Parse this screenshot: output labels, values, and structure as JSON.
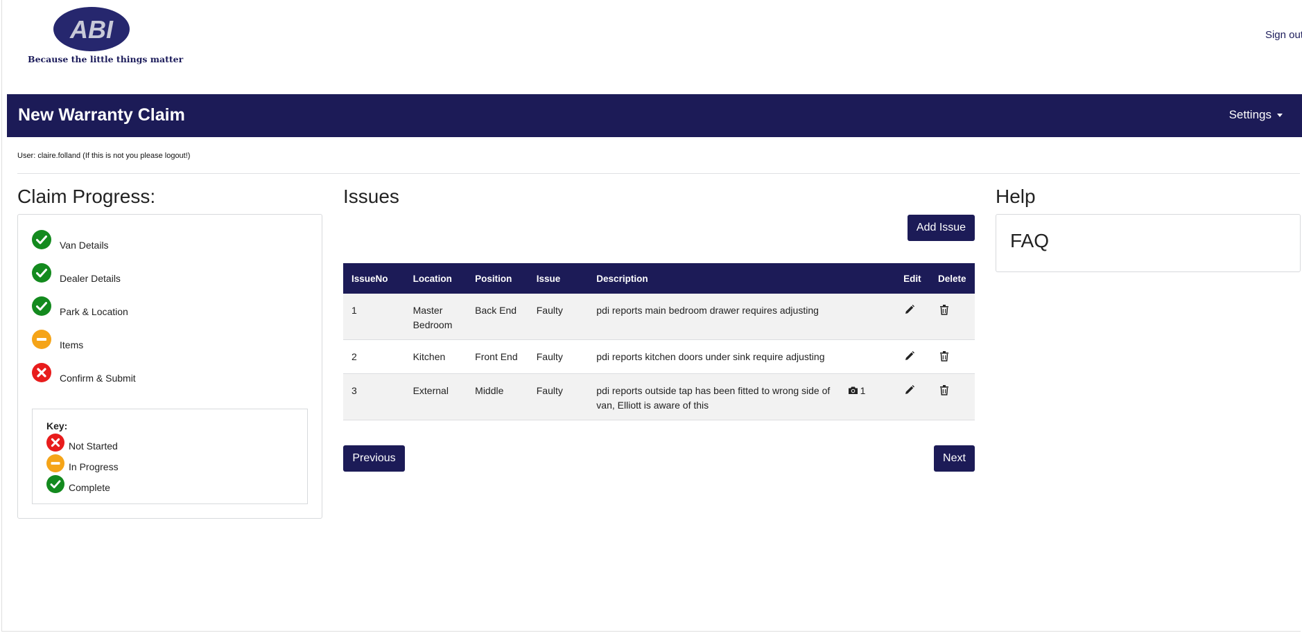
{
  "header": {
    "logo_text": "ABI",
    "tagline": "Because the little things matter",
    "sign_out": "Sign out"
  },
  "navbar": {
    "title": "New Warranty Claim",
    "settings": "Settings"
  },
  "user_line": "User: claire.folland (If this is not you please logout!)",
  "progress": {
    "heading": "Claim Progress:",
    "steps": [
      {
        "label": "Van Details",
        "status": "complete"
      },
      {
        "label": "Dealer Details",
        "status": "complete"
      },
      {
        "label": "Park & Location",
        "status": "complete"
      },
      {
        "label": "Items",
        "status": "in-progress"
      },
      {
        "label": "Confirm & Submit",
        "status": "not-started"
      }
    ],
    "key": {
      "title": "Key:",
      "items": [
        {
          "label": "Not Started",
          "status": "not-started"
        },
        {
          "label": "In Progress",
          "status": "in-progress"
        },
        {
          "label": "Complete",
          "status": "complete"
        }
      ]
    }
  },
  "issues": {
    "heading": "Issues",
    "add_button": "Add Issue",
    "columns": [
      "IssueNo",
      "Location",
      "Position",
      "Issue",
      "Description",
      "",
      "Edit",
      "Delete"
    ],
    "rows": [
      {
        "no": "1",
        "location": "Master Bedroom",
        "position": "Back End",
        "issue": "Faulty",
        "description": "pdi reports main bedroom drawer requires adjusting",
        "photos": ""
      },
      {
        "no": "2",
        "location": "Kitchen",
        "position": "Front End",
        "issue": "Faulty",
        "description": "pdi reports kitchen doors under sink require adjusting",
        "photos": ""
      },
      {
        "no": "3",
        "location": "External",
        "position": "Middle",
        "issue": "Faulty",
        "description": "pdi reports outside tap has been fitted to wrong side of van, Elliott is aware of this",
        "photos": "1"
      }
    ],
    "previous_button": "Previous",
    "next_button": "Next"
  },
  "help": {
    "heading": "Help",
    "faq": "FAQ"
  },
  "colors": {
    "brand": "#1c1b57",
    "complete": "#138a1e",
    "in_progress": "#f5a418",
    "not_started": "#e81c1c"
  }
}
